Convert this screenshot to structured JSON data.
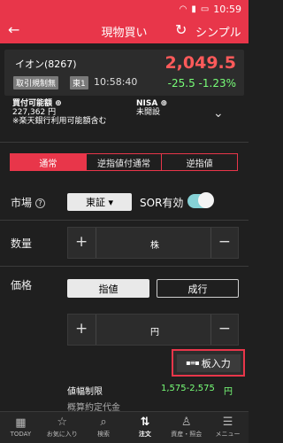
{
  "status_bar": {
    "time": "10:59"
  },
  "header": {
    "title": "現物買い",
    "simple_label": "シンプル"
  },
  "stock": {
    "name": "イオン(8267)",
    "price": "2,049.5",
    "badge_restriction": "取引規制無",
    "badge_market": "東1",
    "time": "10:58:40",
    "change": "-25.5",
    "change_pct": "-1.23%"
  },
  "account": {
    "buying_power_label": "買付可能額",
    "buying_power_value": "227,362 円",
    "buying_power_note": "※楽天銀行利用可能額含む",
    "nisa_label": "NISA",
    "nisa_status": "未開設"
  },
  "order_types": [
    "通常",
    "逆指値付通常",
    "逆指値"
  ],
  "market": {
    "label": "市場",
    "selected": "東証",
    "sor_label": "SOR有効"
  },
  "quantity": {
    "label": "数量",
    "unit": "株"
  },
  "price": {
    "label": "価格",
    "limit_label": "指値",
    "market_label": "成行",
    "unit": "円"
  },
  "board_input": {
    "label": "板入力"
  },
  "price_limit": {
    "label": "値幅制限",
    "value": "1,575-2,575",
    "unit": "円"
  },
  "partial_label": "概算約定代金",
  "tabs": [
    {
      "label": "TODAY",
      "icon": "calendar-icon"
    },
    {
      "label": "お気に入り",
      "icon": "star-icon"
    },
    {
      "label": "検索",
      "icon": "search-icon"
    },
    {
      "label": "注文",
      "icon": "order-icon"
    },
    {
      "label": "資産・照会",
      "icon": "person-icon"
    },
    {
      "label": "メニュー",
      "icon": "menu-icon"
    }
  ],
  "colors": {
    "accent": "#e8364a",
    "up": "#ff5a5a",
    "down": "#78ff78"
  }
}
